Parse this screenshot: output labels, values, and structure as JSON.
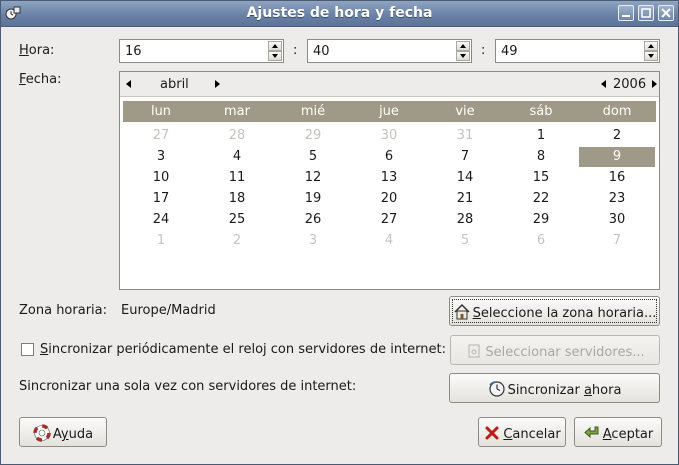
{
  "window": {
    "title": "Ajustes de hora y fecha",
    "icon": "clock-app-icon",
    "controls": [
      "minimize-icon",
      "maximize-icon",
      "close-icon"
    ]
  },
  "time": {
    "label": "Hora:",
    "label_mnemonic": "H",
    "label_rest": "ora:",
    "hours": "16",
    "minutes": "40",
    "seconds": "49",
    "separator": ":"
  },
  "date": {
    "label": "Fecha:",
    "label_mnemonic": "F",
    "label_rest": "echa:",
    "month": "abril",
    "year": "2006",
    "weekdays": [
      "lun",
      "mar",
      "mié",
      "jue",
      "vie",
      "sáb",
      "dom"
    ],
    "weeks": [
      [
        "27",
        "28",
        "29",
        "30",
        "31",
        "1",
        "2"
      ],
      [
        "3",
        "4",
        "5",
        "6",
        "7",
        "8",
        "9"
      ],
      [
        "10",
        "11",
        "12",
        "13",
        "14",
        "15",
        "16"
      ],
      [
        "17",
        "18",
        "19",
        "20",
        "21",
        "22",
        "23"
      ],
      [
        "24",
        "25",
        "26",
        "27",
        "28",
        "29",
        "30"
      ],
      [
        "1",
        "2",
        "3",
        "4",
        "5",
        "6",
        "7"
      ]
    ],
    "selected_day": "9",
    "highlight_color": "#9e9a87"
  },
  "timezone": {
    "label": "Zona horaria:",
    "value": "Europe/Madrid",
    "button_mnemonic": "S",
    "button_rest": "eleccione la zona horaria..."
  },
  "sync": {
    "periodic_label": "Sincronizar periódicamente el reloj con servidores de internet:",
    "periodic_mnemonic": "S",
    "periodic_rest": "incronizar periódicamente el reloj con servidores de internet:",
    "periodic_checked": false,
    "servers_button": "Seleccionar servidores...",
    "once_label": "Sincronizar una sola vez con servidores de internet:",
    "now_button_pre": "Sincronizar ",
    "now_button_mnemonic": "a",
    "now_button_post": "hora"
  },
  "footer": {
    "help_pre": "A",
    "help_mnemonic": "y",
    "help_post": "uda",
    "cancel_mnemonic": "C",
    "cancel_rest": "ancelar",
    "accept_mnemonic": "A",
    "accept_rest": "ceptar"
  }
}
